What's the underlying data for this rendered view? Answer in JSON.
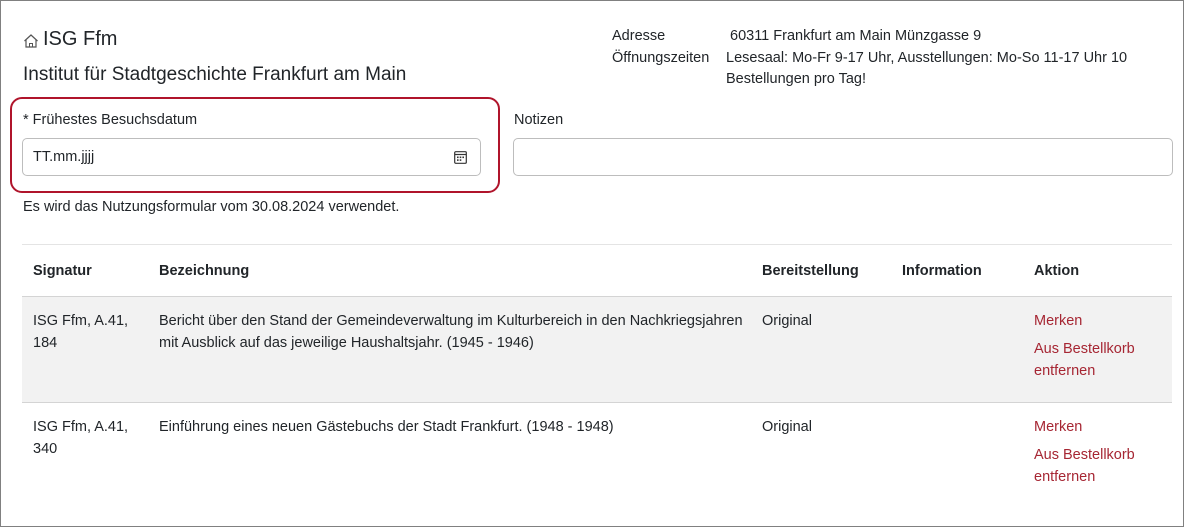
{
  "header": {
    "brand": "ISG Ffm",
    "institute": "Institut für Stadtgeschichte Frankfurt am Main"
  },
  "info": {
    "address_label": "Adresse",
    "address_value": "60311 Frankfurt am Main Münzgasse 9",
    "hours_label": "Öffnungszeiten",
    "hours_value": "Lesesaal: Mo-Fr 9-17 Uhr, Ausstellungen: Mo-So 11-17 Uhr 10 Bestellungen pro Tag!"
  },
  "form": {
    "date_label": "* Frühestes Besuchsdatum",
    "date_placeholder": "TT.mm.jjjj",
    "notes_label": "Notizen",
    "notes_value": "",
    "form_note": "Es wird das Nutzungsformular vom 30.08.2024 verwendet."
  },
  "table": {
    "columns": [
      "Signatur",
      "Bezeichnung",
      "Bereitstellung",
      "Information",
      "Aktion"
    ],
    "rows": [
      {
        "signatur": "ISG Ffm, A.41, 184",
        "bezeichnung": "Bericht über den Stand der Gemeindeverwaltung im Kulturbereich in den Nachkriegsjahren mit Ausblick auf das jeweilige Haushaltsjahr. (1945 - 1946)",
        "bereitstellung": "Original",
        "information": "",
        "action_merken": "Merken",
        "action_remove": "Aus Bestellkorb entfernen"
      },
      {
        "signatur": "ISG Ffm, A.41, 340",
        "bezeichnung": "Einführung eines neuen Gästebuchs der Stadt Frankfurt. (1948 - 1948)",
        "bereitstellung": "Original",
        "information": "",
        "action_merken": "Merken",
        "action_remove": "Aus Bestellkorb entfernen"
      }
    ]
  },
  "colors": {
    "highlight_border": "#b0142b",
    "action_link": "#a62633",
    "row_highlight": "#f2f2f2"
  },
  "icons": {
    "brand_icon": "home-icon",
    "date_icon": "calendar-icon"
  }
}
